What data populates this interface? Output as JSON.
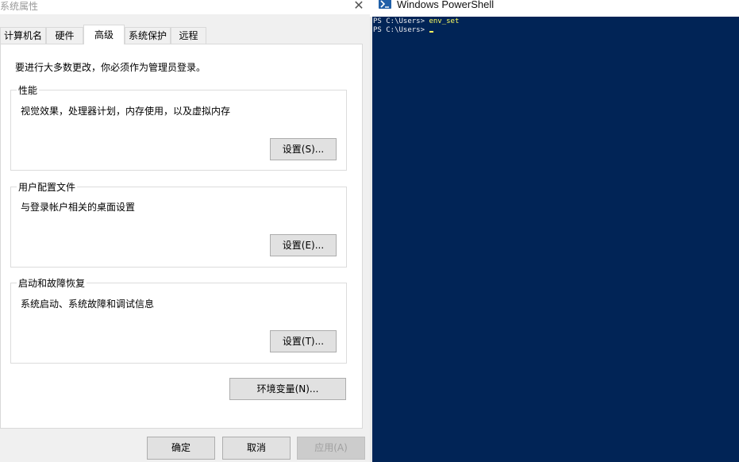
{
  "dialog": {
    "title": "系统属性",
    "close_glyph": "✕",
    "tabs": [
      {
        "label": "计算机名",
        "active": false
      },
      {
        "label": "硬件",
        "active": false
      },
      {
        "label": "高级",
        "active": true
      },
      {
        "label": "系统保护",
        "active": false
      },
      {
        "label": "远程",
        "active": false
      }
    ],
    "intro": "要进行大多数更改，你必须作为管理员登录。",
    "groups": [
      {
        "label": "性能",
        "description": "视觉效果，处理器计划，内存使用，以及虚拟内存",
        "button": "设置(S)..."
      },
      {
        "label": "用户配置文件",
        "description": "与登录帐户相关的桌面设置",
        "button": "设置(E)..."
      },
      {
        "label": "启动和故障恢复",
        "description": "系统启动、系统故障和调试信息",
        "button": "设置(T)..."
      }
    ],
    "env_button": "环境变量(N)...",
    "footer": {
      "ok": "确定",
      "cancel": "取消",
      "apply": "应用(A)"
    }
  },
  "powershell": {
    "title": "Windows PowerShell",
    "lines": [
      {
        "prompt": "PS C:\\Users> ",
        "command": "env_set"
      },
      {
        "prompt": "PS C:\\Users> ",
        "command": ""
      }
    ],
    "colors": {
      "background": "#012456",
      "command": "#ffff60",
      "text": "#eeedf0"
    }
  }
}
